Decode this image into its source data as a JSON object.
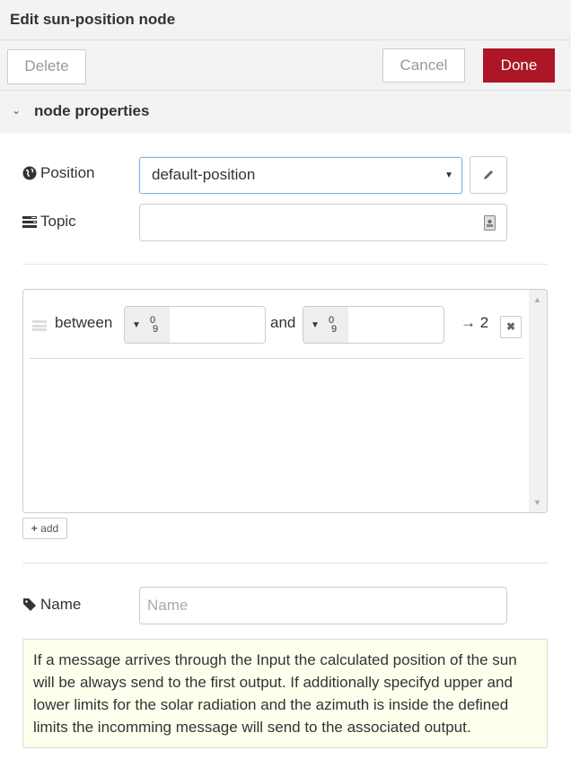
{
  "header": {
    "title": "Edit sun-position node"
  },
  "toolbar": {
    "delete_label": "Delete",
    "cancel_label": "Cancel",
    "done_label": "Done",
    "done_color": "#ad1625"
  },
  "section": {
    "label": "node properties"
  },
  "fields": {
    "position": {
      "label": "Position",
      "value": "default-position",
      "icon": "globe-icon"
    },
    "topic": {
      "label": "Topic",
      "value": "",
      "icon": "tasks-icon"
    },
    "name": {
      "label": "Name",
      "value": "",
      "placeholder": "Name",
      "icon": "tag-icon"
    }
  },
  "rules": [
    {
      "prefix": "between",
      "joiner": "and",
      "type_label": "0 9",
      "output": "→ 2"
    }
  ],
  "add_label": "add",
  "tip": "If a message arrives through the Input the calculated position of the sun will be always send to the first output. If additionally specifyd upper and lower limits for the solar radiation and the azimuth is inside the defined limits the incomming message will send to the associated output."
}
